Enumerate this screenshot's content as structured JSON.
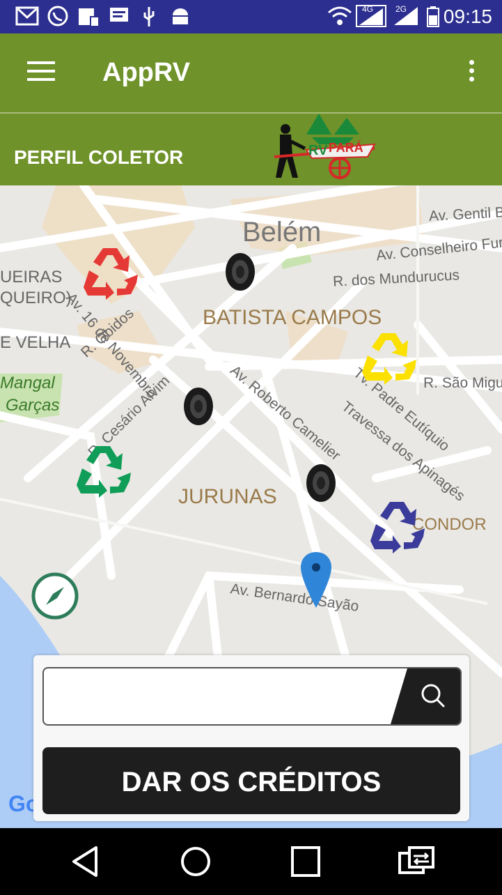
{
  "status_bar": {
    "time": "09:15",
    "network_4g": "4G",
    "network_2g": "2G",
    "icons": [
      "gmail-icon",
      "whatsapp-icon",
      "sim-icon",
      "message-icon",
      "usb-icon",
      "android-icon",
      "wifi-icon",
      "signal-icon",
      "battery-icon"
    ]
  },
  "app_bar": {
    "title": "AppRV",
    "menu_icon": "hamburger-icon",
    "overflow_icon": "more-vert-icon",
    "background": "#6f922a"
  },
  "profile_bar": {
    "label": "PERFIL COLETOR",
    "logo_text_rv": "RV",
    "logo_text_para": "PARÁ"
  },
  "map": {
    "districts": [
      "Belém",
      "BATISTA CAMPOS",
      "JURUNAS",
      "CONDOR"
    ],
    "streets": [
      "Av. Gentil B",
      "Av. Conselheiro Fur",
      "R. dos Mundurucus",
      "R. São Migue",
      "R. Óbidos",
      "Av. 16 de Novembro",
      "R. Cesário Alvim",
      "Av. Roberto Camelier",
      "Tv. Padre Eutíquio",
      "Travessa dos Apinagés",
      "Av. Bernardo Sayão"
    ],
    "partial_labels": [
      "UEIRAS",
      "QUEIRO)",
      "E VELHA",
      "Mangal",
      "Garças"
    ],
    "markers": [
      {
        "type": "recycle",
        "color": "#e53935"
      },
      {
        "type": "recycle",
        "color": "#fbe000"
      },
      {
        "type": "recycle",
        "color": "#0f9d58"
      },
      {
        "type": "recycle",
        "color": "#3a3b9a"
      },
      {
        "type": "tire"
      },
      {
        "type": "tire"
      },
      {
        "type": "tire"
      },
      {
        "type": "location-pin",
        "color": "#2f86d8"
      }
    ],
    "compass_icon": "compass-icon",
    "google_logo": "Go"
  },
  "search": {
    "value": "",
    "placeholder": "",
    "icon": "search-icon"
  },
  "credits_button": {
    "label": "DAR OS CRÉDITOS"
  },
  "nav_bar": {
    "buttons": [
      "back-icon",
      "home-icon",
      "recents-icon",
      "switch-icon"
    ]
  }
}
